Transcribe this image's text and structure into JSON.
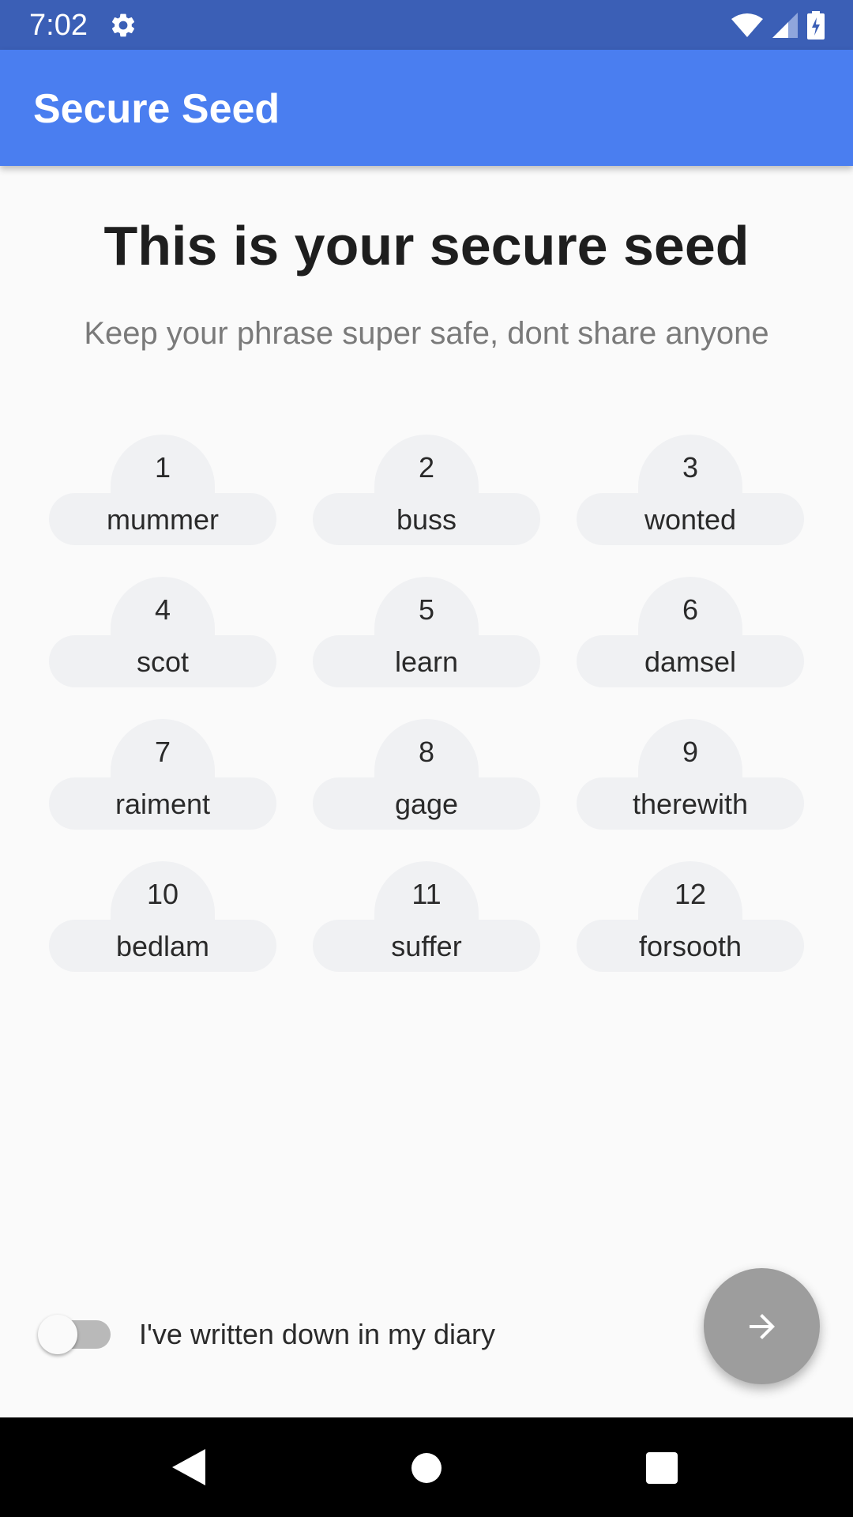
{
  "status_bar": {
    "time": "7:02",
    "icons": [
      "settings-gear-icon",
      "wifi-icon",
      "cell-signal-icon",
      "battery-charging-icon"
    ]
  },
  "app_bar": {
    "title": "Secure Seed",
    "color": "#4a7ef0"
  },
  "main": {
    "headline": "This is your secure seed",
    "subtitle": "Keep your phrase super safe, dont share anyone",
    "seed_words": [
      {
        "number": "1",
        "word": "mummer"
      },
      {
        "number": "2",
        "word": "buss"
      },
      {
        "number": "3",
        "word": "wonted"
      },
      {
        "number": "4",
        "word": "scot"
      },
      {
        "number": "5",
        "word": "learn"
      },
      {
        "number": "6",
        "word": "damsel"
      },
      {
        "number": "7",
        "word": "raiment"
      },
      {
        "number": "8",
        "word": "gage"
      },
      {
        "number": "9",
        "word": "therewith"
      },
      {
        "number": "10",
        "word": "bedlam"
      },
      {
        "number": "11",
        "word": "suffer"
      },
      {
        "number": "12",
        "word": "forsooth"
      }
    ]
  },
  "footer": {
    "toggle_label": "I've written down in my diary",
    "toggle_on": false,
    "next_button_icon": "arrow-right-icon",
    "next_button_enabled": false
  },
  "nav_bar": {
    "icons": [
      "back-icon",
      "home-icon",
      "recents-icon"
    ]
  }
}
